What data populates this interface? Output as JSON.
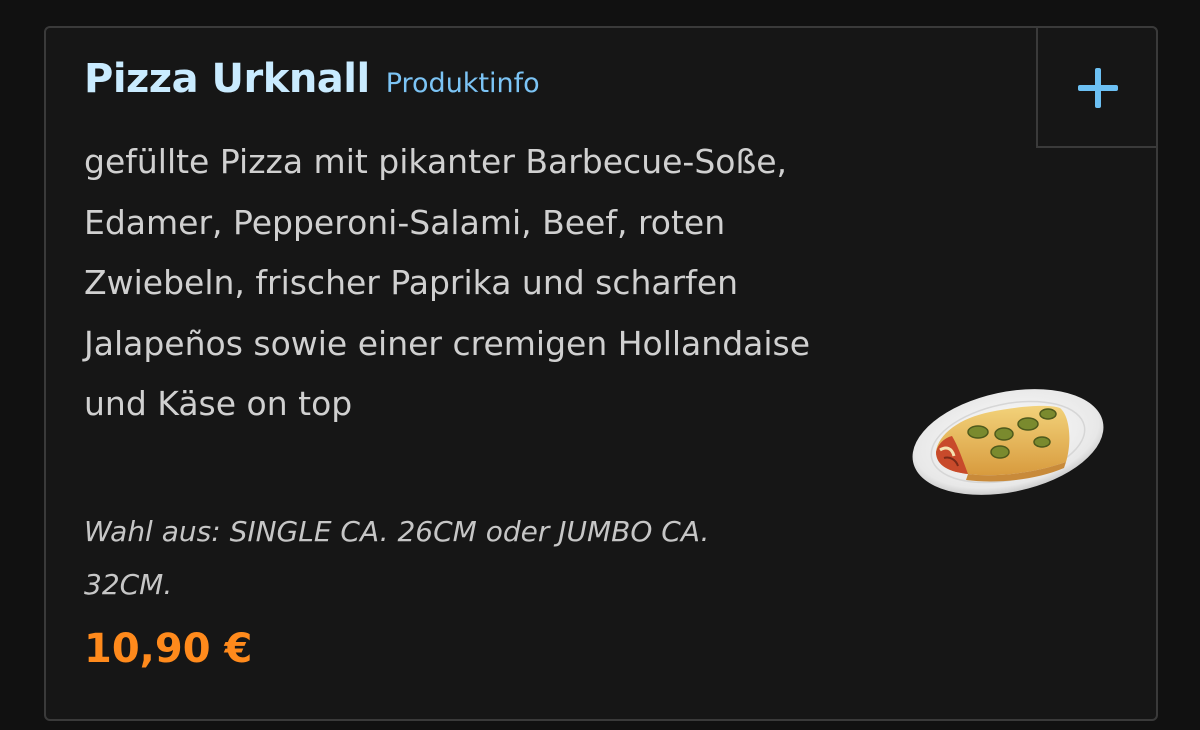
{
  "product": {
    "name": "Pizza Urknall",
    "info_link": "Produktinfo",
    "description": "gefüllte Pizza mit pikanter Barbecue-Soße, Edamer, Pepperoni-Salami, Beef, roten Zwiebeln, frischer Paprika und scharfen Jalapeños sowie einer cremigen Hollandaise und Käse on top",
    "variant_note": "Wahl aus: SINGLE CA. 26CM oder JUMBO CA. 32CM.",
    "price": "10,90 €"
  },
  "icons": {
    "add": "plus-icon",
    "image": "pizza-image"
  },
  "colors": {
    "background": "#111111",
    "card_border": "#3a3a3a",
    "title": "#c9ebff",
    "link": "#7cc4f5",
    "text": "#d0d0d0",
    "price": "#ff8a1c",
    "accent": "#6cc0f3"
  }
}
